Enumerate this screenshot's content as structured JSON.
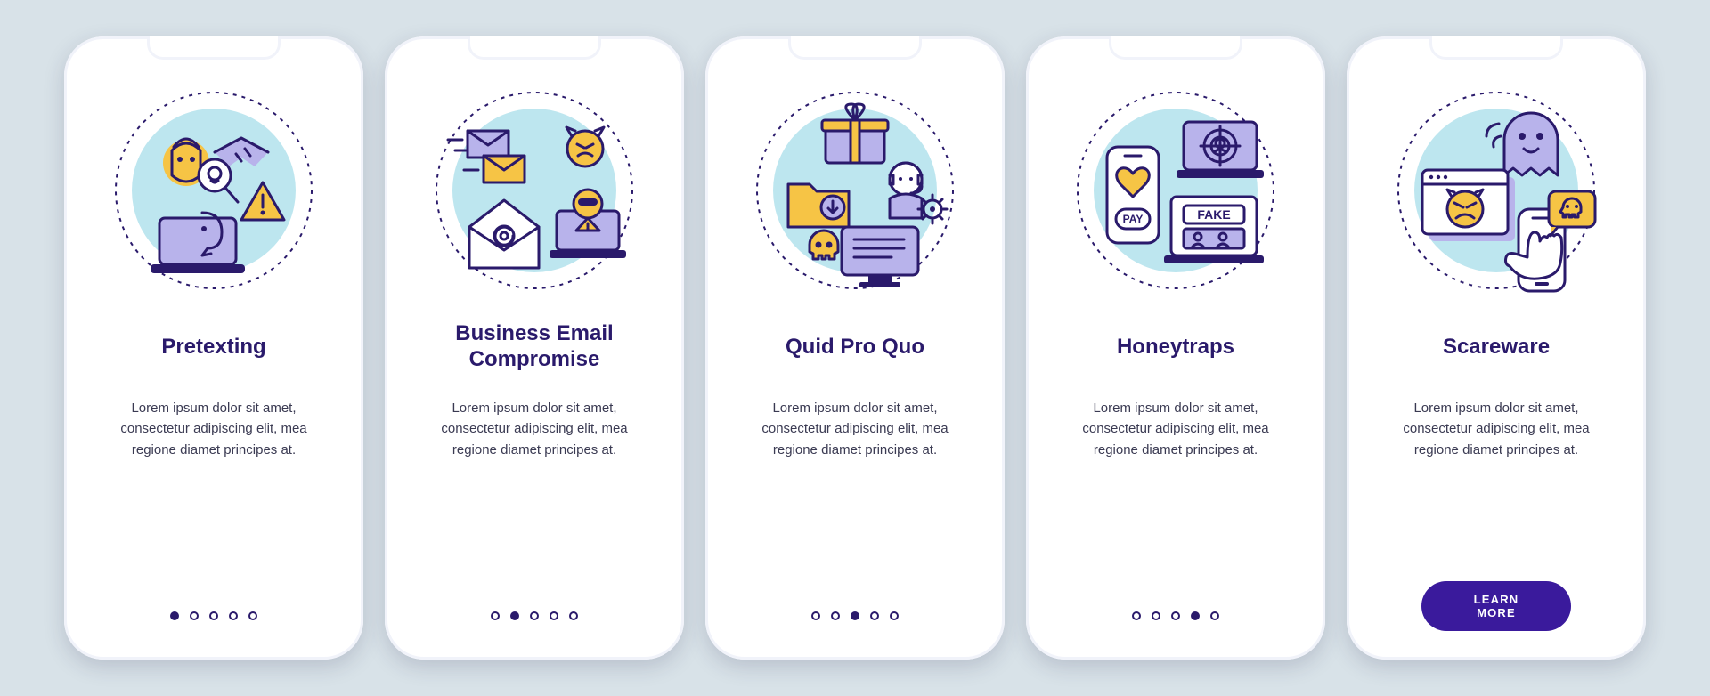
{
  "colors": {
    "bg": "#d8e2e8",
    "card": "#ffffff",
    "primary": "#2a1a6b",
    "accent_purple": "#3a1a9c",
    "lavender": "#b8b3eb",
    "yellow": "#f6c445",
    "sky": "#bde6ef"
  },
  "total_dots": 5,
  "lorem": "Lorem ipsum dolor sit amet, consectetur adipiscing elit, mea regione diamet principes at.",
  "cta_label": "LEARN MORE",
  "screens": [
    {
      "id": "pretexting",
      "title": "Pretexting",
      "icon": "pretexting-icon",
      "active_index": 0,
      "show_cta": false
    },
    {
      "id": "bec",
      "title": "Business Email Compromise",
      "icon": "bec-icon",
      "active_index": 1,
      "show_cta": false
    },
    {
      "id": "quid",
      "title": "Quid Pro Quo",
      "icon": "quid-icon",
      "active_index": 2,
      "show_cta": false
    },
    {
      "id": "honeytraps",
      "title": "Honeytraps",
      "icon": "honeytraps-icon",
      "active_index": 3,
      "show_cta": false
    },
    {
      "id": "scareware",
      "title": "Scareware",
      "icon": "scareware-icon",
      "active_index": 4,
      "show_cta": true
    }
  ]
}
